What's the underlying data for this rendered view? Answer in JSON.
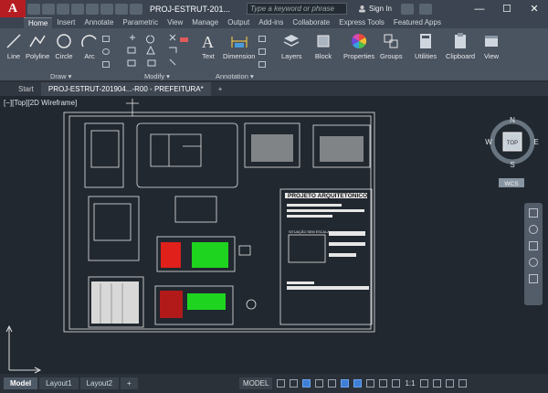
{
  "app": {
    "logo": "A",
    "doc_title": "PROJ-ESTRUT-201...",
    "search_placeholder": "Type a keyword or phrase",
    "signin": "Sign In",
    "win_min": "—",
    "win_max": "☐",
    "win_close": "✕"
  },
  "menu": {
    "tabs": [
      "Home",
      "Insert",
      "Annotate",
      "Parametric",
      "View",
      "Manage",
      "Output",
      "Add-ins",
      "Collaborate",
      "Express Tools",
      "Featured Apps"
    ]
  },
  "ribbon": {
    "draw": {
      "line": "Line",
      "polyline": "Polyline",
      "circle": "Circle",
      "arc": "Arc",
      "panel": "Draw ▾"
    },
    "modify": {
      "panel": "Modify ▾"
    },
    "annotation": {
      "text": "Text",
      "dimension": "Dimension",
      "panel": "Annotation ▾"
    },
    "layers": "Layers",
    "block": "Block",
    "properties": "Properties",
    "groups": "Groups",
    "utilities": "Utilities",
    "clipboard": "Clipboard",
    "view": "View"
  },
  "file_tabs": {
    "start": "Start",
    "drawing": "PROJ-ESTRUT-201904...-R00 - PREFEITURA*",
    "plus": "+"
  },
  "viewport": {
    "label": "[−][Top][2D Wireframe]",
    "sheet": {
      "title_block": "PROJETO ARQUITETÔNICO",
      "stamp": "SITUAÇÃO SEM ESCALA"
    },
    "viewcube": {
      "n": "N",
      "s": "S",
      "e": "E",
      "w": "W",
      "face": "TOP",
      "wcs": "WCS"
    }
  },
  "layouts": {
    "model": "Model",
    "l1": "Layout1",
    "l2": "Layout2",
    "plus": "+"
  },
  "status": {
    "model": "MODEL",
    "scale": "1:1"
  }
}
